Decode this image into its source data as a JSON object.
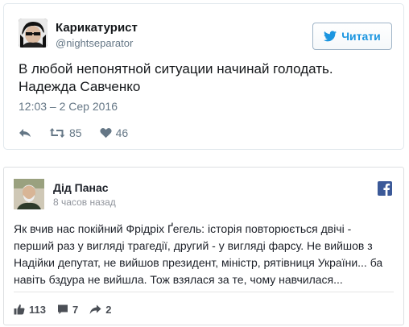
{
  "tweet": {
    "author_name": "Карикатурист",
    "author_handle": "@nightseparator",
    "follow_label": "Читати",
    "text_line1": "В любой непонятной ситуации начинай голодать.",
    "text_line2": "Надежда Савченко",
    "timestamp": "12:03 – 2 Сер 2016",
    "retweet_count": "85",
    "like_count": "46"
  },
  "fb_post": {
    "author_name": "Дід Панас",
    "time_ago": "8 часов назад",
    "text_lines": [
      "Як вчив нас покійний Фрідріх Ґегель: історія повторюється двічі -",
      "перший раз у вигляді трагедії, другий - у вигляді фарсу. Не вийшов з",
      "Надійки депутат, не вийшов президент, міністр, рятівниця України... ба",
      "навіть бздура не вийшла. Тож взялася за те, чому навчилася..."
    ],
    "like_count": "113",
    "comment_count": "7",
    "share_count": "2"
  },
  "colors": {
    "twitter_blue": "#1b95e0",
    "twitter_gray": "#657786",
    "facebook_blue": "#3b5998",
    "facebook_gray": "#4b4f56"
  }
}
